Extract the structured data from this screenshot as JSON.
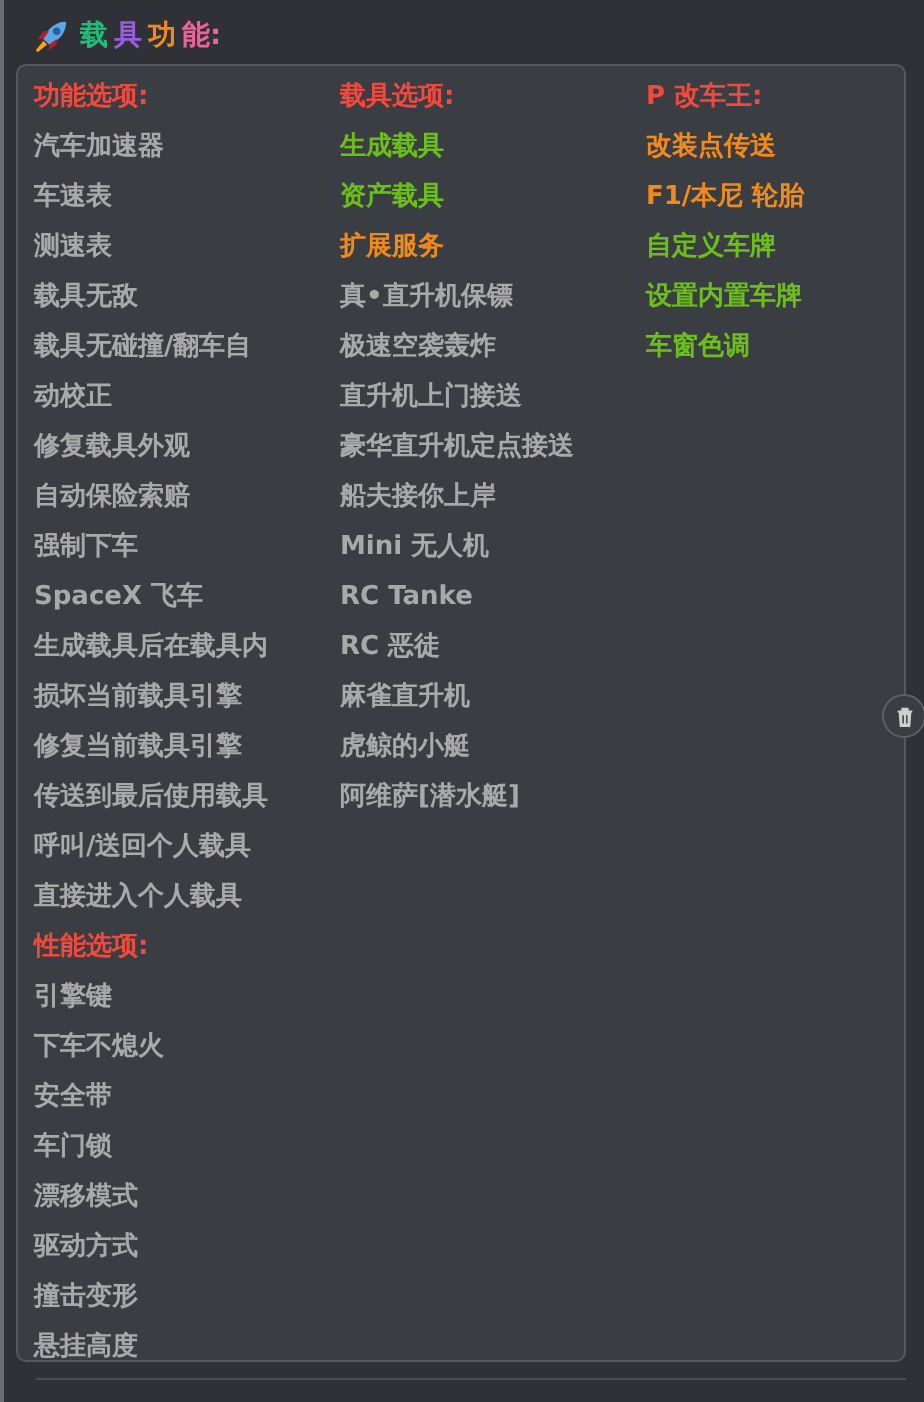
{
  "title": [
    {
      "text": "载",
      "color": "#1fbf7a"
    },
    {
      "text": "具",
      "color": "#9a5ce0"
    },
    {
      "text": "功",
      "color": "#f08a1c"
    },
    {
      "text": "能:",
      "color": "#f0609a"
    }
  ],
  "columns": [
    [
      {
        "text": "功能选项:",
        "color": "#f04a3e"
      },
      {
        "text": "汽车加速器",
        "color": "#a9a9a9"
      },
      {
        "text": "车速表",
        "color": "#a9a9a9"
      },
      {
        "text": "测速表",
        "color": "#a9a9a9"
      },
      {
        "text": "载具无敌",
        "color": "#a9a9a9"
      },
      {
        "text": "载具无碰撞/翻车自",
        "color": "#a9a9a9"
      },
      {
        "text": "动校正",
        "color": "#a9a9a9"
      },
      {
        "text": "修复载具外观",
        "color": "#a9a9a9"
      },
      {
        "text": "自动保险索赔",
        "color": "#a9a9a9"
      },
      {
        "text": "强制下车",
        "color": "#a9a9a9"
      },
      {
        "text": "SpaceX 飞车",
        "color": "#a9a9a9"
      },
      {
        "text": "生成载具后在载具内",
        "color": "#a9a9a9"
      },
      {
        "text": "损坏当前载具引擎",
        "color": "#a9a9a9"
      },
      {
        "text": "修复当前载具引擎",
        "color": "#a9a9a9"
      },
      {
        "text": "传送到最后使用载具",
        "color": "#a9a9a9"
      },
      {
        "text": "呼叫/送回个人载具",
        "color": "#a9a9a9"
      },
      {
        "text": "直接进入个人载具",
        "color": "#a9a9a9"
      },
      {
        "text": "性能选项:",
        "color": "#f04a3e"
      },
      {
        "text": "引擎键",
        "color": "#a9a9a9"
      },
      {
        "text": "下车不熄火",
        "color": "#a9a9a9"
      },
      {
        "text": "安全带",
        "color": "#a9a9a9"
      },
      {
        "text": "车门锁",
        "color": "#a9a9a9"
      },
      {
        "text": "漂移模式",
        "color": "#a9a9a9"
      },
      {
        "text": "驱动方式",
        "color": "#a9a9a9"
      },
      {
        "text": "撞击变形",
        "color": "#a9a9a9"
      },
      {
        "text": "悬挂高度",
        "color": "#a9a9a9"
      }
    ],
    [
      {
        "text": "载具选项:",
        "color": "#f04a3e"
      },
      {
        "text": "生成载具",
        "color": "#6cbf1a"
      },
      {
        "text": "资产载具",
        "color": "#6cbf1a"
      },
      {
        "text": "扩展服务",
        "color": "#f08a1c"
      },
      {
        "text": "真•直升机保镖",
        "color": "#a9a9a9"
      },
      {
        "text": "极速空袭轰炸",
        "color": "#a9a9a9"
      },
      {
        "text": "直升机上门接送",
        "color": "#a9a9a9"
      },
      {
        "text": "豪华直升机定点接送",
        "color": "#a9a9a9"
      },
      {
        "text": "船夫接你上岸",
        "color": "#a9a9a9"
      },
      {
        "text": "Mini 无人机",
        "color": "#a9a9a9"
      },
      {
        "text": "RC Tanke",
        "color": "#a9a9a9"
      },
      {
        "text": "RC 恶徒",
        "color": "#a9a9a9"
      },
      {
        "text": "麻雀直升机",
        "color": "#a9a9a9"
      },
      {
        "text": "虎鲸的小艇",
        "color": "#a9a9a9"
      },
      {
        "text": "阿维萨[潜水艇]",
        "color": "#a9a9a9"
      }
    ],
    [
      {
        "text": "P 改车王:",
        "color": "#f04a3e"
      },
      {
        "text": "改装点传送",
        "color": "#f08a1c"
      },
      {
        "text": "F1/本尼 轮胎",
        "color": "#f08a1c"
      },
      {
        "text": "自定义车牌",
        "color": "#6cbf1a"
      },
      {
        "text": "设置内置车牌",
        "color": "#6cbf1a"
      },
      {
        "text": "车窗色调",
        "color": "#6cbf1a"
      }
    ]
  ]
}
